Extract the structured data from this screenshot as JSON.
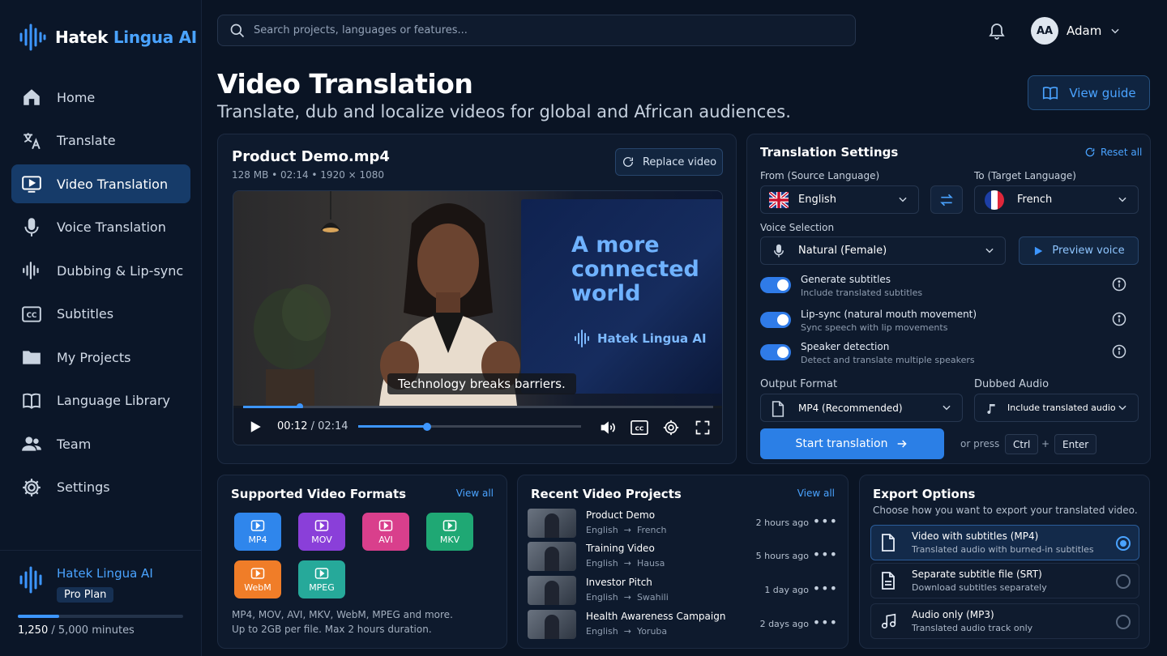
{
  "app": {
    "name_main": "Hatek",
    "name_accent": "Lingua AI"
  },
  "sidebar": {
    "items": [
      {
        "label": "Home",
        "icon": "home-icon"
      },
      {
        "label": "Translate",
        "icon": "translate-icon"
      },
      {
        "label": "Video Translation",
        "icon": "video-icon",
        "active": true
      },
      {
        "label": "Voice Translation",
        "icon": "microphone-icon"
      },
      {
        "label": "Dubbing & Lip-sync",
        "icon": "waveform-icon"
      },
      {
        "label": "Subtitles",
        "icon": "cc-icon"
      },
      {
        "label": "My Projects",
        "icon": "folder-icon"
      },
      {
        "label": "Language Library",
        "icon": "book-icon"
      },
      {
        "label": "Team",
        "icon": "team-icon"
      },
      {
        "label": "Settings",
        "icon": "gear-icon"
      }
    ],
    "plan": {
      "name": "Hatek Lingua AI",
      "badge": "Pro Plan",
      "used": "1,250",
      "total": " / 5,000 minutes",
      "usage_fraction": 0.25
    }
  },
  "header": {
    "search_placeholder": "Search projects, languages or features...",
    "user_initials": "AA",
    "user_name": "Adam"
  },
  "page": {
    "title": "Video Translation",
    "subtitle": "Translate, dub and localize videos for global and African audiences.",
    "guide_label": "View guide"
  },
  "video": {
    "file_name": "Product Demo.mp4",
    "meta": "128 MB  •  02:14  •  1920 × 1080",
    "replace_label": "Replace video",
    "screen_text": "A more connected world",
    "screen_logo": "Hatek Lingua AI",
    "caption": "Technology breaks barriers.",
    "time_current": "00:12",
    "time_total": " / 02:14",
    "progress_fraction": 0.09
  },
  "settings": {
    "title": "Translation Settings",
    "reset_label": "Reset all",
    "from_label": "From (Source Language)",
    "from_value": "English",
    "to_label": "To (Target Language)",
    "to_value": "French",
    "voice_label": "Voice Selection",
    "voice_value": "Natural (Female)",
    "preview_label": "Preview voice",
    "toggles": [
      {
        "title": "Generate subtitles",
        "sub": "Include translated subtitles",
        "on": true
      },
      {
        "title": "Lip-sync (natural mouth movement)",
        "sub": "Sync speech with lip movements",
        "on": true
      },
      {
        "title": "Speaker detection",
        "sub": "Detect and translate multiple speakers",
        "on": true
      }
    ],
    "output_label": "Output Format",
    "output_value": "MP4 (Recommended)",
    "dubbed_label": "Dubbed Audio",
    "dubbed_value": "Include translated audio",
    "start_label": "Start translation",
    "or_press": "or press",
    "key1": "Ctrl",
    "plus": "+",
    "key2": "Enter"
  },
  "formats": {
    "title": "Supported Video Formats",
    "view_all": "View all",
    "items": [
      {
        "label": "MP4",
        "color": "#2f86ec"
      },
      {
        "label": "MOV",
        "color": "#8a3fd9"
      },
      {
        "label": "AVI",
        "color": "#d93f8c"
      },
      {
        "label": "MKV",
        "color": "#1fa874"
      },
      {
        "label": "WebM",
        "color": "#f07d28"
      },
      {
        "label": "MPEG",
        "color": "#26a99a"
      }
    ],
    "note1": "MP4, MOV, AVI, MKV, WebM, MPEG and more.",
    "note2": "Up to 2GB per file. Max 2 hours duration."
  },
  "recent": {
    "title": "Recent Video Projects",
    "view_all": "View all",
    "items": [
      {
        "name": "Product Demo",
        "from": "English",
        "to": "French",
        "time": "2 hours ago"
      },
      {
        "name": "Training Video",
        "from": "English",
        "to": "Hausa",
        "time": "5 hours ago"
      },
      {
        "name": "Investor Pitch",
        "from": "English",
        "to": "Swahili",
        "time": "1 day ago"
      },
      {
        "name": "Health Awareness Campaign",
        "from": "English",
        "to": "Yoruba",
        "time": "2 days ago"
      }
    ]
  },
  "export": {
    "title": "Export Options",
    "sub": "Choose how you want to export your translated video.",
    "options": [
      {
        "title": "Video with subtitles (MP4)",
        "sub": "Translated audio with burned-in subtitles",
        "selected": true
      },
      {
        "title": "Separate subtitle file (SRT)",
        "sub": "Download subtitles separately",
        "selected": false
      },
      {
        "title": "Audio only (MP3)",
        "sub": "Translated audio track only",
        "selected": false
      }
    ]
  },
  "colors": {
    "accent": "#3d96ff",
    "active_nav": "#163b69",
    "background": "#0a1424"
  }
}
